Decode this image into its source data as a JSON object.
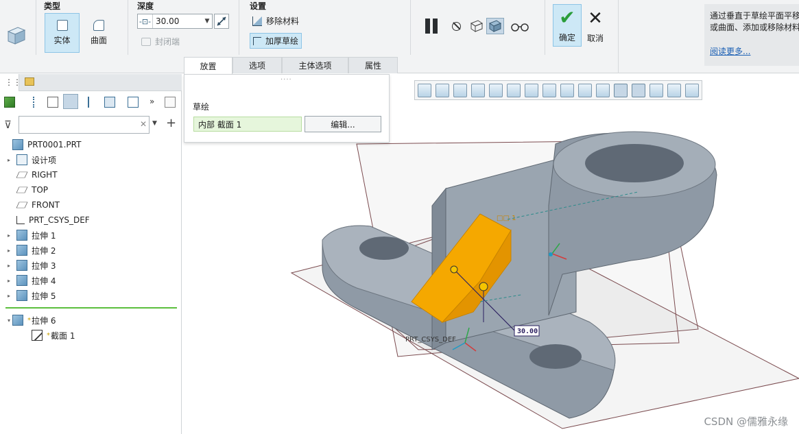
{
  "ribbon": {
    "type_group": {
      "title": "类型",
      "solid": "实体",
      "surface": "曲面"
    },
    "depth_group": {
      "title": "深度",
      "value": "30.00",
      "capped_ends": "封闭端"
    },
    "settings_group": {
      "title": "设置",
      "remove_material": "移除材料",
      "thicken_sketch": "加厚草绘"
    },
    "ok": "确定",
    "cancel": "取消",
    "tabs": [
      "放置",
      "选项",
      "主体选项",
      "属性"
    ],
    "help": {
      "line1": "通过垂直于草绘平面平移",
      "line2": "或曲面、添加或移除材料",
      "more": "阅读更多..."
    }
  },
  "placement_panel": {
    "label": "草绘",
    "sketch_ref": "内部 截面 1",
    "edit_button": "编辑..."
  },
  "model_tree": {
    "items": [
      {
        "label": "PRT0001.PRT",
        "icon": "part-icon",
        "indent": 0,
        "expander": ""
      },
      {
        "label": "设计项",
        "icon": "design-items-icon",
        "indent": 1,
        "expander": "▸"
      },
      {
        "label": "RIGHT",
        "icon": "datum-plane-icon",
        "indent": 1,
        "expander": ""
      },
      {
        "label": "TOP",
        "icon": "datum-plane-icon",
        "indent": 1,
        "expander": ""
      },
      {
        "label": "FRONT",
        "icon": "datum-plane-icon",
        "indent": 1,
        "expander": ""
      },
      {
        "label": "PRT_CSYS_DEF",
        "icon": "csys-icon",
        "indent": 1,
        "expander": ""
      },
      {
        "label": "拉伸 1",
        "icon": "extrude-icon",
        "indent": 1,
        "expander": "▸"
      },
      {
        "label": "拉伸 2",
        "icon": "extrude-icon",
        "indent": 1,
        "expander": "▸"
      },
      {
        "label": "拉伸 3",
        "icon": "extrude-icon",
        "indent": 1,
        "expander": "▸"
      },
      {
        "label": "拉伸 4",
        "icon": "extrude-icon",
        "indent": 1,
        "expander": "▸"
      },
      {
        "label": "拉伸 5",
        "icon": "extrude-icon",
        "indent": 1,
        "expander": "▸"
      }
    ],
    "active": [
      {
        "label": "拉伸 6",
        "icon": "extrude-icon",
        "expander": "▾"
      },
      {
        "label": "截面 1",
        "icon": "sketch-icon",
        "expander": ""
      }
    ]
  },
  "viewport": {
    "csys_label": "PRT_CSYS_DEF",
    "dimension": "30.00",
    "feature_tag": "□□ 1"
  },
  "watermark": "CSDN @儒雅永缘",
  "colors": {
    "accent": "#cde8f6",
    "feature": "#f5a800",
    "model": "#8e99a6"
  }
}
